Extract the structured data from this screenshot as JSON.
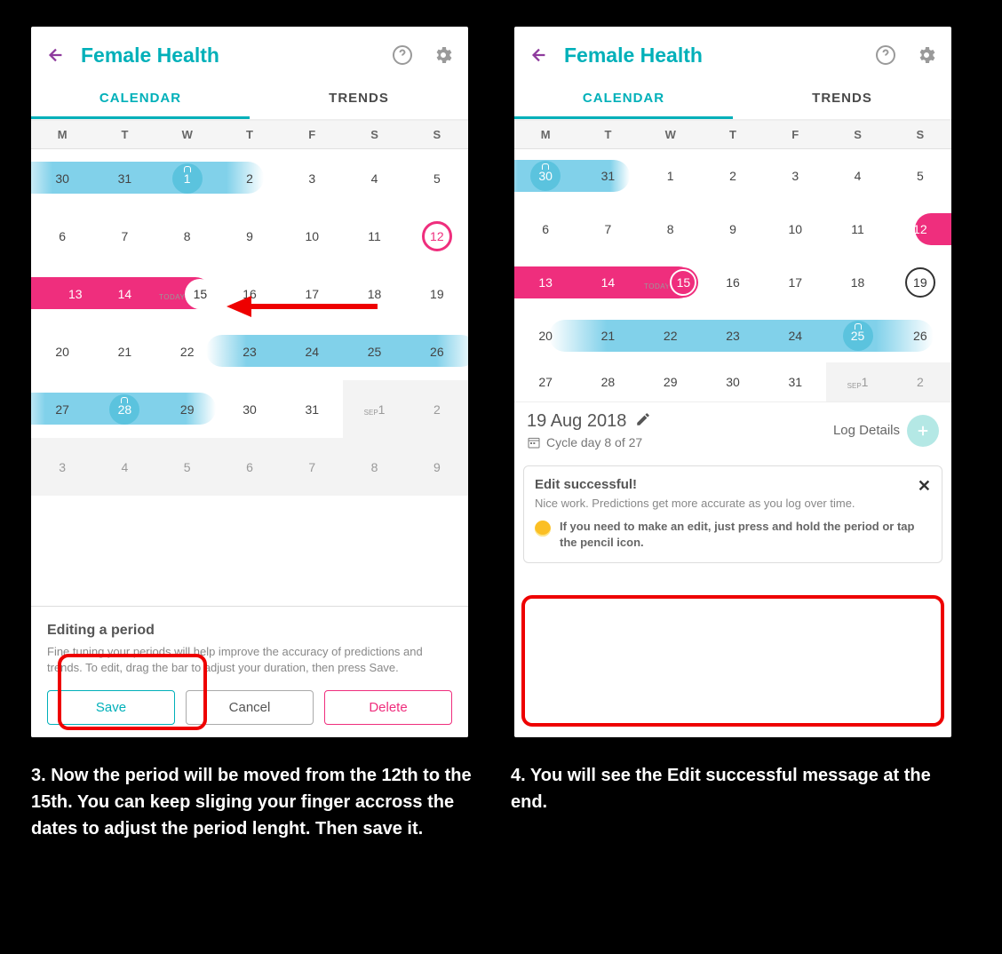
{
  "common": {
    "title": "Female Health",
    "tab_calendar": "CALENDAR",
    "tab_trends": "TRENDS",
    "dow": [
      "M",
      "T",
      "W",
      "T",
      "F",
      "S",
      "S"
    ]
  },
  "phone1": {
    "today_label": "TODAY",
    "month_label": "SEP",
    "rows": [
      [
        "30",
        "31",
        "1",
        "2",
        "3",
        "4",
        "5"
      ],
      [
        "6",
        "7",
        "8",
        "9",
        "10",
        "11",
        "12"
      ],
      [
        "13",
        "14",
        "15",
        "16",
        "17",
        "18",
        "19"
      ],
      [
        "20",
        "21",
        "22",
        "23",
        "24",
        "25",
        "26"
      ],
      [
        "27",
        "28",
        "29",
        "30",
        "31",
        "1",
        "2"
      ],
      [
        "3",
        "4",
        "5",
        "6",
        "7",
        "8",
        "9"
      ]
    ],
    "edit_title": "Editing a period",
    "edit_body": "Fine tuning your periods will help improve the accuracy of predictions and trends. To edit, drag the bar to adjust your duration, then press Save.",
    "save": "Save",
    "cancel": "Cancel",
    "delete": "Delete"
  },
  "phone2": {
    "today_label": "TODAY",
    "month_label": "SEP",
    "rows": [
      [
        "30",
        "31",
        "1",
        "2",
        "3",
        "4",
        "5"
      ],
      [
        "6",
        "7",
        "8",
        "9",
        "10",
        "11",
        "12"
      ],
      [
        "13",
        "14",
        "15",
        "16",
        "17",
        "18",
        "19"
      ],
      [
        "20",
        "21",
        "22",
        "23",
        "24",
        "25",
        "26"
      ],
      [
        "27",
        "28",
        "29",
        "30",
        "31",
        "1",
        "2"
      ]
    ],
    "detail_date": "19 Aug 2018",
    "cycle_text": "Cycle day 8 of 27",
    "log_details": "Log Details",
    "toast_title": "Edit successful!",
    "toast_body": "Nice work. Predictions get more accurate as you log over time.",
    "toast_tip": "If you need to make an edit, just press and hold the period or tap the pencil icon."
  },
  "captions": {
    "c3": "3.  Now the period will be moved from the 12th to the 15th. You can keep sliging your finger accross the dates to adjust the period lenght. Then save it.",
    "c4": "4. You will see the Edit successful message at the end."
  },
  "colors": {
    "teal": "#00b0b9",
    "pink": "#ef2e7d",
    "blue": "#81d1ea",
    "annot_red": "#e00"
  }
}
